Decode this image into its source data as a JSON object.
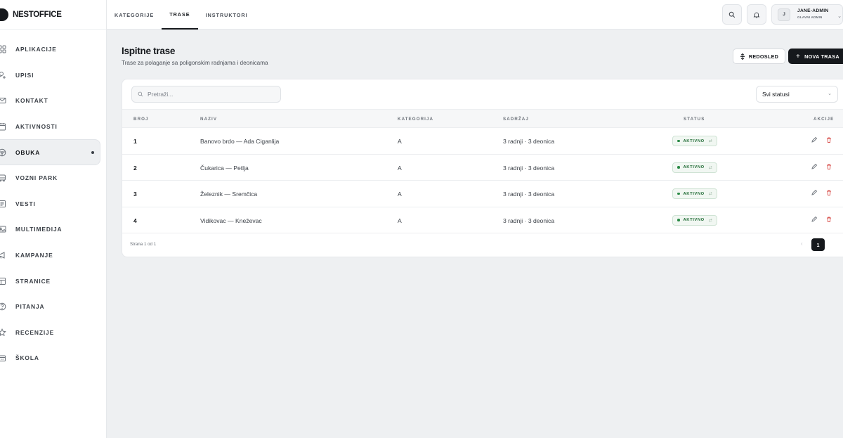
{
  "brand": {
    "name_bold": "NEST",
    "name_rest": "OFFICE"
  },
  "sidebar": {
    "items": [
      {
        "label": "APLIKACIJE",
        "icon": "grid-icon"
      },
      {
        "label": "UPISI",
        "icon": "user-add-icon"
      },
      {
        "label": "KONTAKT",
        "icon": "mail-icon"
      },
      {
        "label": "AKTIVNOSTI",
        "icon": "calendar-icon"
      },
      {
        "label": "OBUKA",
        "icon": "steering-wheel-icon",
        "active": true
      },
      {
        "label": "VOZNI PARK",
        "icon": "car-icon"
      },
      {
        "label": "VESTI",
        "icon": "news-icon"
      },
      {
        "label": "MULTIMEDIJA",
        "icon": "image-icon"
      },
      {
        "label": "KAMPANJE",
        "icon": "megaphone-icon"
      },
      {
        "label": "STRANICE",
        "icon": "page-icon"
      },
      {
        "label": "PITANJA",
        "icon": "question-icon"
      },
      {
        "label": "RECENZIJE",
        "icon": "star-icon"
      },
      {
        "label": "ŠKOLA",
        "icon": "school-icon"
      }
    ]
  },
  "topbar": {
    "tabs": [
      {
        "label": "KATEGORIJE"
      },
      {
        "label": "TRASE",
        "active": true
      },
      {
        "label": "INSTRUKTORI"
      }
    ],
    "user": {
      "initial": "J",
      "name": "JANE-ADMIN",
      "role": "GLAVNI ADMIN"
    }
  },
  "page": {
    "title": "Ispitne trase",
    "subtitle": "Trase za polaganje sa poligonskim radnjama i deonicama",
    "reorder_label": "REDOSLED",
    "new_label": "NOVA TRASA"
  },
  "filters": {
    "search_placeholder": "Pretraži...",
    "status_value": "Svi statusi"
  },
  "table": {
    "headers": {
      "num": "BROJ",
      "name": "NAZIV",
      "category": "KATEGORIJA",
      "content": "SADRŽAJ",
      "status": "STATUS",
      "actions": "AKCIJE"
    },
    "rows": [
      {
        "num": "1",
        "name": "Banovo brdo — Ada Ciganlija",
        "category": "A",
        "content": "3 radnji · 3 deonica",
        "status": "AKTIVNO"
      },
      {
        "num": "2",
        "name": "Čukarica — Petlja",
        "category": "A",
        "content": "3 radnji · 3 deonica",
        "status": "AKTIVNO"
      },
      {
        "num": "3",
        "name": "Železnik — Sremčica",
        "category": "A",
        "content": "3 radnji · 3 deonica",
        "status": "AKTIVNO"
      },
      {
        "num": "4",
        "name": "Vidikovac — Kneževac",
        "category": "A",
        "content": "3 radnji · 3 deonica",
        "status": "AKTIVNO"
      }
    ]
  },
  "pagination": {
    "summary": "Strana 1 od 1",
    "current_page": "1"
  },
  "colors": {
    "accent": "#15181c",
    "active_badge": "#1f6b34",
    "delete": "#d9534f"
  }
}
